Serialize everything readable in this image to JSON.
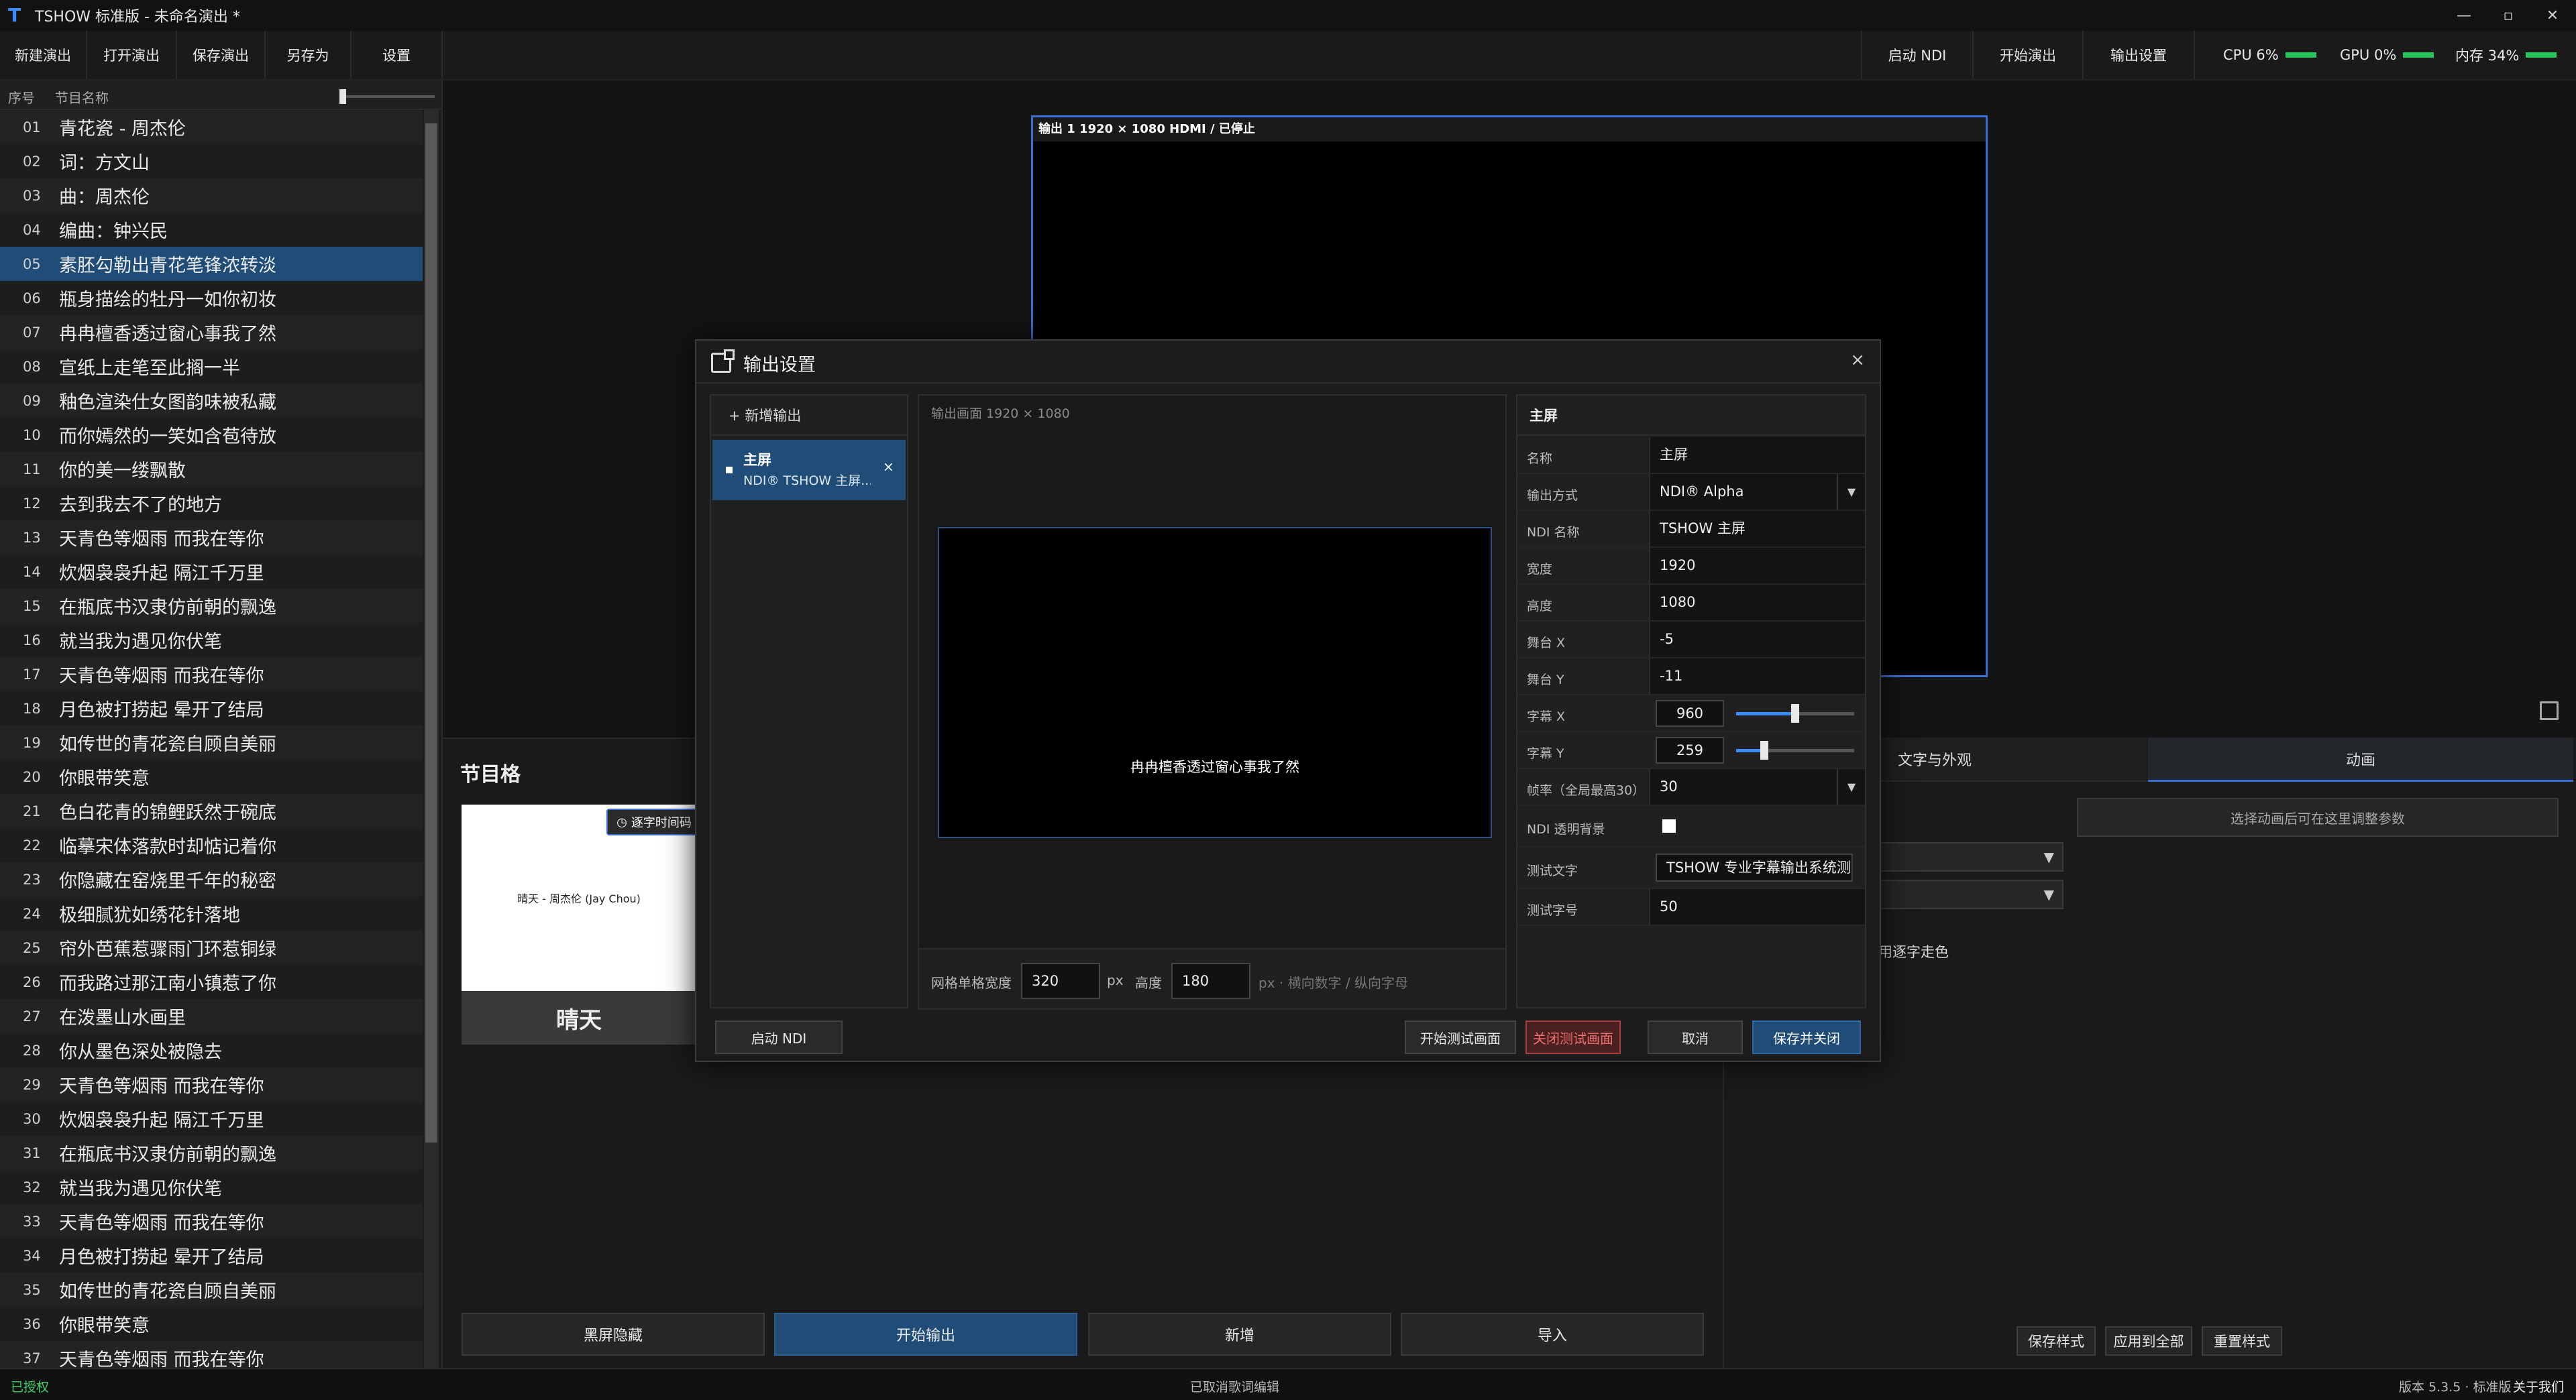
{
  "titlebar": {
    "title": "TSHOW 标准版 - 未命名演出 *",
    "logo": "T",
    "minimize": "—",
    "maximize": "▫",
    "close": "✕"
  },
  "toolbar": {
    "left": [
      "新建演出",
      "打开演出",
      "保存演出",
      "另存为",
      "设置"
    ],
    "right": [
      "启动 NDI",
      "开始演出",
      "输出设置"
    ],
    "meters": [
      {
        "label": "CPU 6%",
        "value": 0.06
      },
      {
        "label": "GPU 0%",
        "value": 0.0
      },
      {
        "label": "内存 34%",
        "value": 0.34
      }
    ]
  },
  "list": {
    "col_index": "序号",
    "col_name": "节目名称",
    "selected_index": 4,
    "items": [
      {
        "n": "01",
        "t": "青花瓷 - 周杰伦"
      },
      {
        "n": "02",
        "t": "词：方文山"
      },
      {
        "n": "03",
        "t": "曲：周杰伦"
      },
      {
        "n": "04",
        "t": "编曲：钟兴民"
      },
      {
        "n": "05",
        "t": "素胚勾勒出青花笔锋浓转淡"
      },
      {
        "n": "06",
        "t": "瓶身描绘的牡丹一如你初妆"
      },
      {
        "n": "07",
        "t": "冉冉檀香透过窗心事我了然"
      },
      {
        "n": "08",
        "t": "宣纸上走笔至此搁一半"
      },
      {
        "n": "09",
        "t": "釉色渲染仕女图韵味被私藏"
      },
      {
        "n": "10",
        "t": "而你嫣然的一笑如含苞待放"
      },
      {
        "n": "11",
        "t": "你的美一缕飘散"
      },
      {
        "n": "12",
        "t": "去到我去不了的地方"
      },
      {
        "n": "13",
        "t": "天青色等烟雨 而我在等你"
      },
      {
        "n": "14",
        "t": "炊烟袅袅升起 隔江千万里"
      },
      {
        "n": "15",
        "t": "在瓶底书汉隶仿前朝的飘逸"
      },
      {
        "n": "16",
        "t": "就当我为遇见你伏笔"
      },
      {
        "n": "17",
        "t": "天青色等烟雨 而我在等你"
      },
      {
        "n": "18",
        "t": "月色被打捞起 晕开了结局"
      },
      {
        "n": "19",
        "t": "如传世的青花瓷自顾自美丽"
      },
      {
        "n": "20",
        "t": "你眼带笑意"
      },
      {
        "n": "21",
        "t": "色白花青的锦鲤跃然于碗底"
      },
      {
        "n": "22",
        "t": "临摹宋体落款时却惦记着你"
      },
      {
        "n": "23",
        "t": "你隐藏在窑烧里千年的秘密"
      },
      {
        "n": "24",
        "t": "极细腻犹如绣花针落地"
      },
      {
        "n": "25",
        "t": "帘外芭蕉惹骤雨门环惹铜绿"
      },
      {
        "n": "26",
        "t": "而我路过那江南小镇惹了你"
      },
      {
        "n": "27",
        "t": "在泼墨山水画里"
      },
      {
        "n": "28",
        "t": "你从墨色深处被隐去"
      },
      {
        "n": "29",
        "t": "天青色等烟雨 而我在等你"
      },
      {
        "n": "30",
        "t": "炊烟袅袅升起 隔江千万里"
      },
      {
        "n": "31",
        "t": "在瓶底书汉隶仿前朝的飘逸"
      },
      {
        "n": "32",
        "t": "就当我为遇见你伏笔"
      },
      {
        "n": "33",
        "t": "天青色等烟雨 而我在等你"
      },
      {
        "n": "34",
        "t": "月色被打捞起 晕开了结局"
      },
      {
        "n": "35",
        "t": "如传世的青花瓷自顾自美丽"
      },
      {
        "n": "36",
        "t": "你眼带笑意"
      },
      {
        "n": "37",
        "t": "天青色等烟雨 而我在等你"
      }
    ]
  },
  "preview": {
    "caption": "输出 1  1920 × 1080  HDMI / 已停止"
  },
  "grid": {
    "title": "节目格",
    "card_preview_text": "晴天 - 周杰伦 (Jay Chou)",
    "card_name": "晴天",
    "tag": "逐字时间码",
    "buttons": [
      "黑屏隐藏",
      "开始输出",
      "新增",
      "导入"
    ]
  },
  "right_panel": {
    "tabs": [
      "文字与外观",
      "动画"
    ],
    "hint": "选择动画后可在这里调整参数",
    "option_partial": "用逐字走色",
    "buttons": [
      "保存样式",
      "应用到全部",
      "重置样式"
    ]
  },
  "status": {
    "left": "已授权",
    "center": "已取消歌词编辑",
    "version": "版本 5.3.5 · 标准版",
    "about": "关于我们"
  },
  "modal": {
    "title": "输出设置",
    "close": "×",
    "add_output": "+  新增输出",
    "output_item": {
      "name": "主屏",
      "desc": "NDI® TSHOW 主屏...",
      "remove": "×"
    },
    "canvas_caption": "输出画面 1920 × 1080",
    "canvas_text": "冉冉檀香透过窗心事我了然",
    "grid_width_label": "网格单格宽度",
    "grid_width": "320",
    "px": "px",
    "grid_height_label": "高度",
    "grid_height": "180",
    "grid_hint": "px · 横向数字 / 纵向字母",
    "props_title": "主屏",
    "props": {
      "name": {
        "label": "名称",
        "value": "主屏"
      },
      "mode": {
        "label": "输出方式",
        "value": "NDI® Alpha"
      },
      "ndi_name": {
        "label": "NDI 名称",
        "value": "TSHOW 主屏"
      },
      "width": {
        "label": "宽度",
        "value": "1920"
      },
      "height": {
        "label": "高度",
        "value": "1080"
      },
      "stage_x": {
        "label": "舞台 X",
        "value": "-5"
      },
      "stage_y": {
        "label": "舞台 Y",
        "value": "-11"
      },
      "sub_x": {
        "label": "字幕 X",
        "value": "960",
        "fraction": 0.5
      },
      "sub_y": {
        "label": "字幕 Y",
        "value": "259",
        "fraction": 0.24
      },
      "fps": {
        "label": "帧率（全局最高30）",
        "value": "30"
      },
      "ndi_bg": {
        "label": "NDI 透明背景"
      },
      "test_text": {
        "label": "测试文字",
        "value": "TSHOW 专业字幕输出系统测"
      },
      "test_size": {
        "label": "测试字号",
        "value": "50"
      }
    },
    "footer": {
      "start_ndi": "启动 NDI",
      "start_test": "开始测试画面",
      "stop_test": "关闭测试画面",
      "cancel": "取消",
      "save": "保存并关闭"
    }
  }
}
